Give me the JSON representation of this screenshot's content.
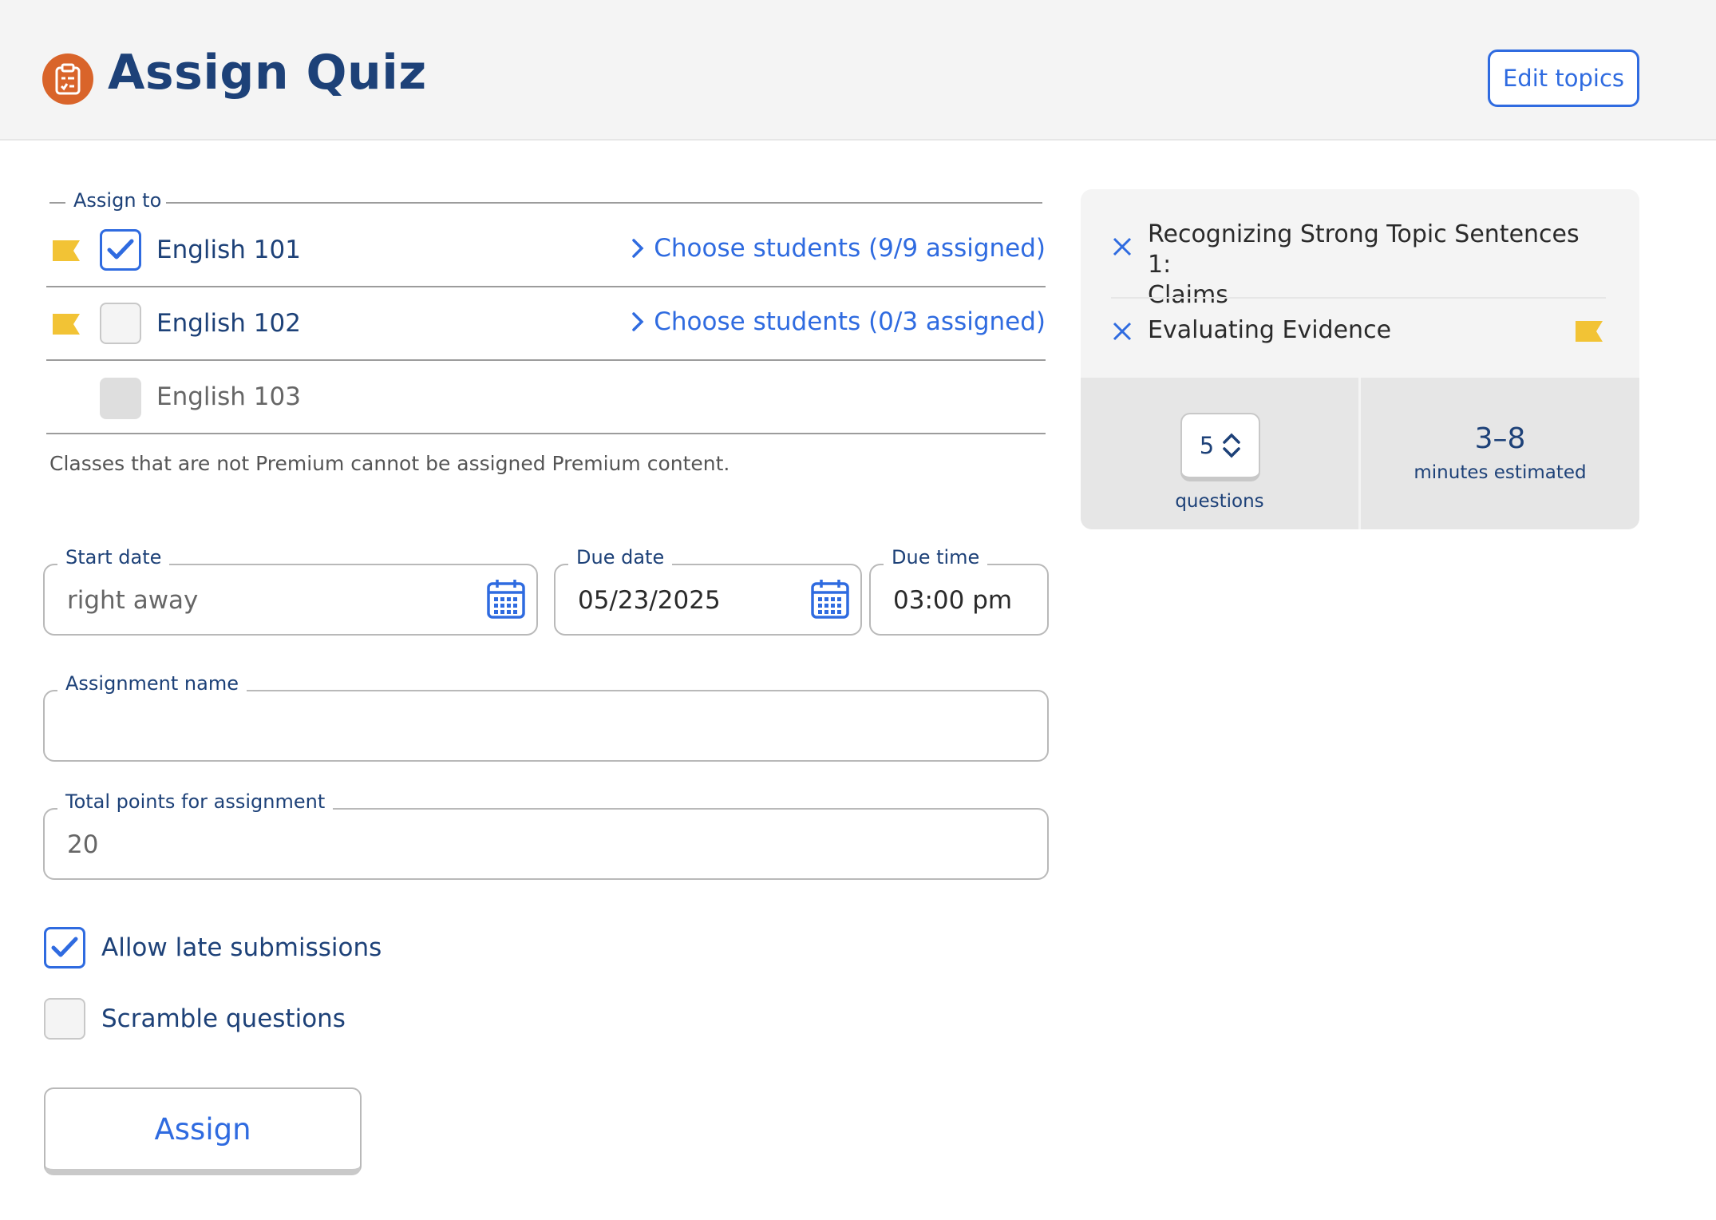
{
  "header": {
    "title": "Assign Quiz",
    "icon": "clipboard-check-icon",
    "edit_topics_label": "Edit topics"
  },
  "assign_to": {
    "legend": "Assign to",
    "classes": [
      {
        "name": "English 101",
        "checked": true,
        "premium": true,
        "link": "Choose students (9/9 assigned)"
      },
      {
        "name": "English 102",
        "checked": false,
        "premium": true,
        "link": "Choose students (0/3 assigned)"
      },
      {
        "name": "English 103",
        "checked": false,
        "premium": false,
        "disabled": true,
        "link": ""
      }
    ],
    "note": "Classes that are not Premium cannot be assigned Premium content."
  },
  "fields": {
    "start_date": {
      "label": "Start date",
      "placeholder": "right away"
    },
    "due_date": {
      "label": "Due date",
      "value": "05/23/2025"
    },
    "due_time": {
      "label": "Due time",
      "value": "03:00 pm"
    },
    "assignment_name": {
      "label": "Assignment name",
      "value": ""
    },
    "total_points": {
      "label": "Total points for assignment",
      "placeholder": "20"
    }
  },
  "options": {
    "allow_late": {
      "label": "Allow late submissions",
      "checked": true
    },
    "scramble": {
      "label": "Scramble questions",
      "checked": false
    }
  },
  "assign_button": "Assign",
  "topics_panel": {
    "topics": [
      {
        "line1": "Recognizing Strong Topic Sentences 1:",
        "line2": "Claims",
        "premium": false
      },
      {
        "line1": "Evaluating Evidence",
        "line2": "",
        "premium": true
      }
    ],
    "questions_value": "5",
    "questions_label": "questions",
    "estimate_value": "3–8",
    "estimate_label": "minutes estimated"
  },
  "colors": {
    "accent": "#2f6be0",
    "title": "#1d4178",
    "header_icon": "#d9642a",
    "premium_flag": "#f2c335"
  }
}
